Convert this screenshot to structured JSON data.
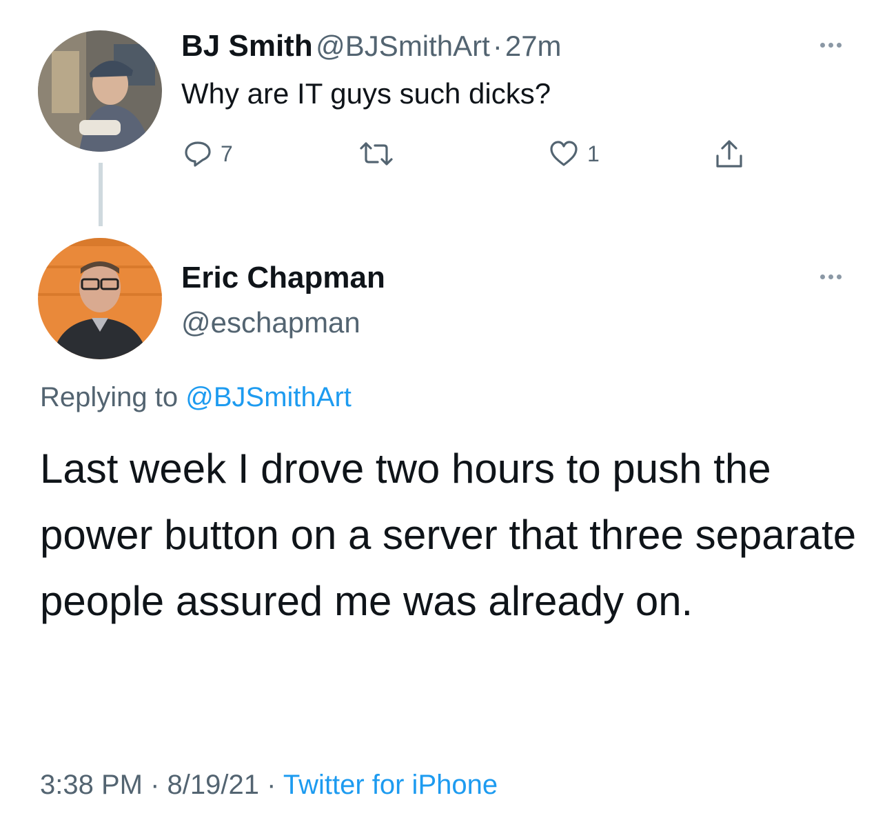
{
  "original_tweet": {
    "author_name": "BJ Smith",
    "author_handle": "@BJSmithArt",
    "separator": "·",
    "time_ago": "27m",
    "text": "Why are IT guys such dicks?",
    "reply_count": "7",
    "retweet_count": "",
    "like_count": "1",
    "icons": [
      "reply-icon",
      "retweet-icon",
      "like-icon",
      "share-icon",
      "more-icon"
    ]
  },
  "reply_tweet": {
    "author_name": "Eric Chapman",
    "author_handle": "@eschapman",
    "replying_prefix": "Replying to",
    "replying_to": "@BJSmithArt",
    "text": "Last week I drove two hours to push the power button on a server that three separate people assured me was already on.",
    "time": "3:38 PM",
    "date": "8/19/21",
    "source": "Twitter for iPhone",
    "separator": "·"
  },
  "colors": {
    "text_primary": "#0f1419",
    "text_secondary": "#536471",
    "link": "#1d9bf0",
    "thread_line": "#cfd9de"
  }
}
